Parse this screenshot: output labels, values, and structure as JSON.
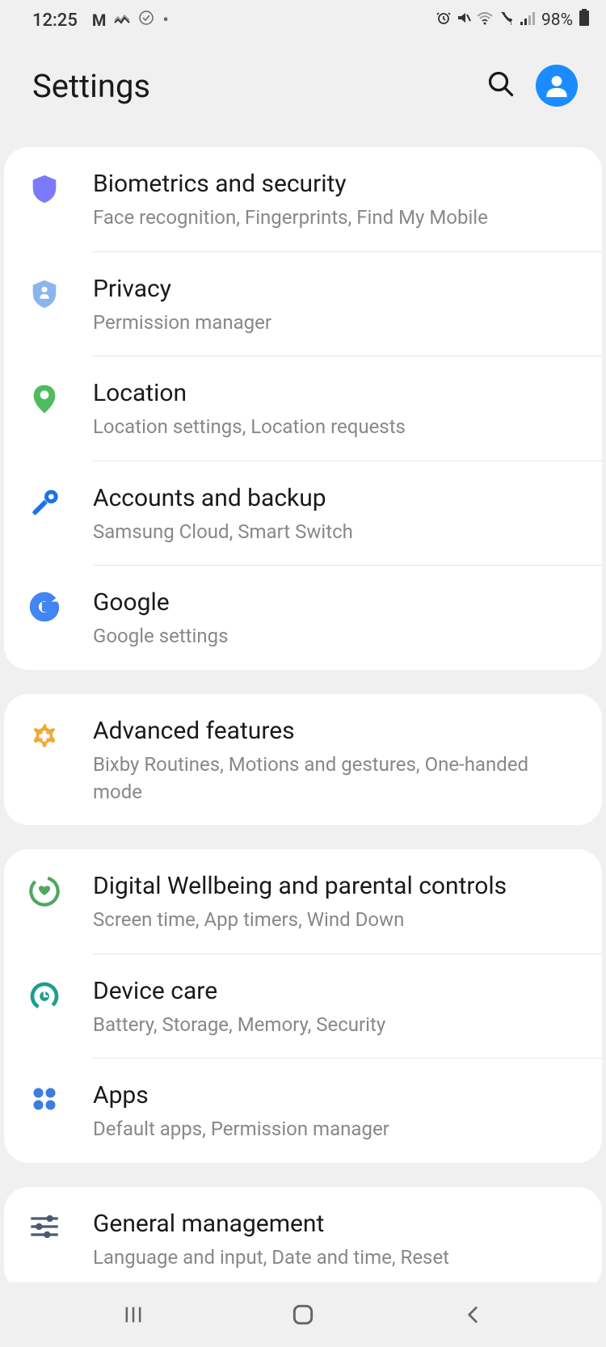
{
  "statusBar": {
    "time": "12:25",
    "battery": "98%"
  },
  "header": {
    "title": "Settings"
  },
  "groups": [
    {
      "items": [
        {
          "icon": "shield-icon",
          "iconColor": "#7b7afc",
          "title": "Biometrics and security",
          "subtitle": "Face recognition, Fingerprints, Find My Mobile"
        },
        {
          "icon": "privacy-shield-icon",
          "iconColor": "#8bb5ee",
          "title": "Privacy",
          "subtitle": "Permission manager"
        },
        {
          "icon": "location-pin-icon",
          "iconColor": "#4fbb5e",
          "title": "Location",
          "subtitle": "Location settings, Location requests"
        },
        {
          "icon": "key-icon",
          "iconColor": "#1a73e8",
          "title": "Accounts and backup",
          "subtitle": "Samsung Cloud, Smart Switch"
        },
        {
          "icon": "google-g-icon",
          "iconColor": "#4285f4",
          "title": "Google",
          "subtitle": "Google settings"
        }
      ]
    },
    {
      "items": [
        {
          "icon": "gear-plus-icon",
          "iconColor": "#f0a933",
          "title": "Advanced features",
          "subtitle": "Bixby Routines, Motions and gestures, One-handed mode"
        }
      ]
    },
    {
      "items": [
        {
          "icon": "wellbeing-icon",
          "iconColor": "#4ea85e",
          "title": "Digital Wellbeing and parental controls",
          "subtitle": "Screen time, App timers, Wind Down"
        },
        {
          "icon": "device-care-icon",
          "iconColor": "#1b9e8f",
          "title": "Device care",
          "subtitle": "Battery, Storage, Memory, Security"
        },
        {
          "icon": "apps-grid-icon",
          "iconColor": "#3d7de0",
          "title": "Apps",
          "subtitle": "Default apps, Permission manager"
        }
      ]
    },
    {
      "items": [
        {
          "icon": "sliders-icon",
          "iconColor": "#6b7280",
          "title": "General management",
          "subtitle": "Language and input, Date and time, Reset"
        }
      ]
    }
  ]
}
